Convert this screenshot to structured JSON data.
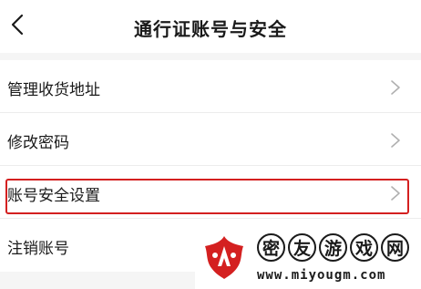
{
  "header": {
    "title": "通行证账号与安全",
    "back_icon": "back-chevron-icon"
  },
  "menu": {
    "items": [
      {
        "label": "管理收货地址",
        "icon": "chevron-right-icon"
      },
      {
        "label": "修改密码",
        "icon": "chevron-right-icon"
      },
      {
        "label": "账号安全设置",
        "icon": "chevron-right-icon",
        "highlighted": true
      },
      {
        "label": "注销账号"
      }
    ]
  },
  "annotation": {
    "color": "#d42020"
  },
  "watermark": {
    "chars": [
      "密",
      "友",
      "游",
      "戏",
      "网"
    ],
    "url": "www.miyougm.com",
    "logo_color": "#d42020"
  }
}
